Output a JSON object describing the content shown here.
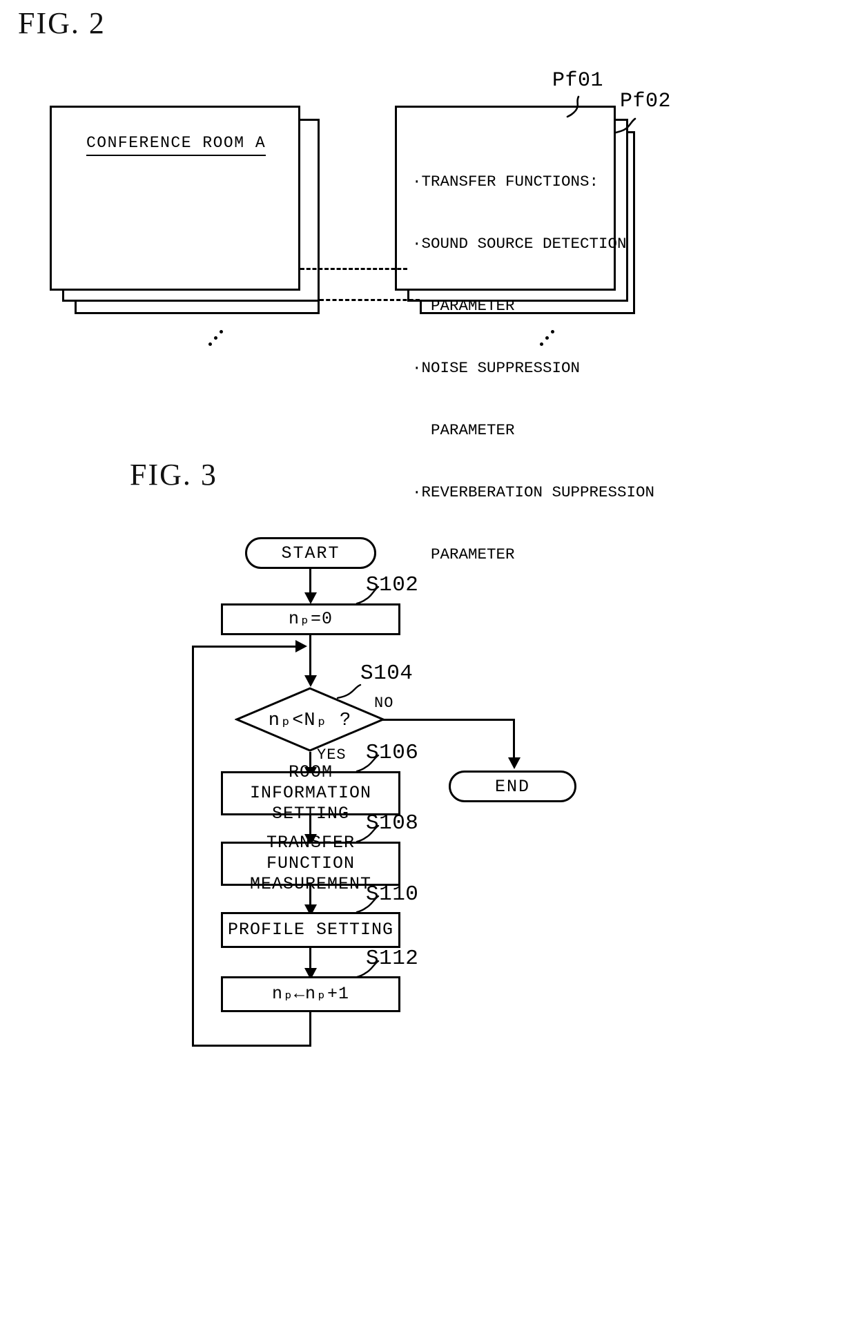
{
  "figures": {
    "fig2": {
      "caption": "FIG. 2",
      "room_box": {
        "title": "CONFERENCE ROOM A"
      },
      "profile_box": {
        "lines": [
          "·TRANSFER FUNCTIONS:",
          "·SOUND SOURCE DETECTION",
          "  PARAMETER",
          "·NOISE SUPPRESSION",
          "  PARAMETER",
          "·REVERBERATION SUPPRESSION",
          "  PARAMETER"
        ]
      },
      "ref_labels": {
        "pf01": "Pf01",
        "pf02": "Pf02"
      }
    },
    "fig3": {
      "caption": "FIG. 3",
      "nodes": {
        "start": "START",
        "end": "END",
        "s102": "nₚ=0",
        "s104": "nₚ<Nₚ ?",
        "s106": "ROOM INFORMATION\nSETTING",
        "s108": "TRANSFER FUNCTION\nMEASUREMENT",
        "s110": "PROFILE SETTING",
        "s112": "nₚ←nₚ+1"
      },
      "step_labels": {
        "s102": "S102",
        "s104": "S104",
        "s106": "S106",
        "s108": "S108",
        "s110": "S110",
        "s112": "S112"
      },
      "branch_labels": {
        "no": "NO",
        "yes": "YES"
      }
    }
  },
  "colors": {
    "ink": "#000000",
    "paper": "#ffffff"
  }
}
